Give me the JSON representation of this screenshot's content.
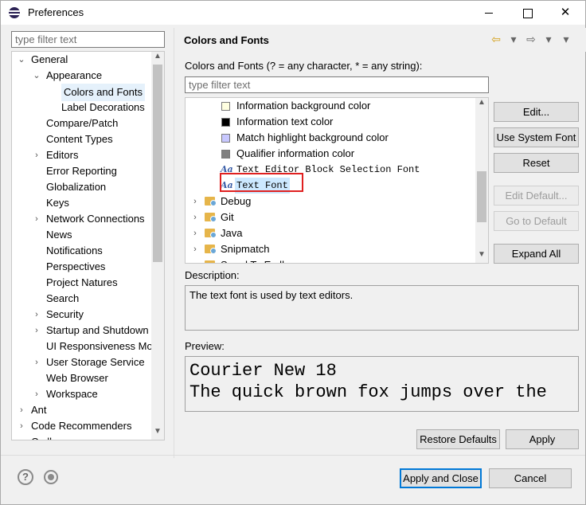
{
  "window": {
    "title": "Preferences",
    "minimize_label": "",
    "close_label": "✕"
  },
  "left": {
    "filter_placeholder": "type filter text",
    "tree": [
      {
        "label": "General",
        "indent": 0,
        "chevron": "⌄"
      },
      {
        "label": "Appearance",
        "indent": 1,
        "chevron": "⌄"
      },
      {
        "label": "Colors and Fonts",
        "indent": 2,
        "chevron": "",
        "selected": true
      },
      {
        "label": "Label Decorations",
        "indent": 2,
        "chevron": ""
      },
      {
        "label": "Compare/Patch",
        "indent": 1,
        "chevron": ""
      },
      {
        "label": "Content Types",
        "indent": 1,
        "chevron": ""
      },
      {
        "label": "Editors",
        "indent": 1,
        "chevron": "›"
      },
      {
        "label": "Error Reporting",
        "indent": 1,
        "chevron": ""
      },
      {
        "label": "Globalization",
        "indent": 1,
        "chevron": ""
      },
      {
        "label": "Keys",
        "indent": 1,
        "chevron": ""
      },
      {
        "label": "Network Connections",
        "indent": 1,
        "chevron": "›"
      },
      {
        "label": "News",
        "indent": 1,
        "chevron": ""
      },
      {
        "label": "Notifications",
        "indent": 1,
        "chevron": ""
      },
      {
        "label": "Perspectives",
        "indent": 1,
        "chevron": ""
      },
      {
        "label": "Project Natures",
        "indent": 1,
        "chevron": ""
      },
      {
        "label": "Search",
        "indent": 1,
        "chevron": ""
      },
      {
        "label": "Security",
        "indent": 1,
        "chevron": "›"
      },
      {
        "label": "Startup and Shutdown",
        "indent": 1,
        "chevron": "›"
      },
      {
        "label": "UI Responsiveness Mo",
        "indent": 1,
        "chevron": ""
      },
      {
        "label": "User Storage Service",
        "indent": 1,
        "chevron": "›"
      },
      {
        "label": "Web Browser",
        "indent": 1,
        "chevron": ""
      },
      {
        "label": "Workspace",
        "indent": 1,
        "chevron": "›"
      },
      {
        "label": "Ant",
        "indent": 0,
        "chevron": "›"
      },
      {
        "label": "Code Recommenders",
        "indent": 0,
        "chevron": "›"
      },
      {
        "label": "C...ll",
        "indent": 0,
        "chevron": ""
      }
    ]
  },
  "page": {
    "title": "Colors and Fonts",
    "nav": {
      "back": "⇦",
      "back_menu": "▾",
      "forward": "⇨",
      "forward_menu": "▾",
      "view_menu": "▾"
    },
    "filter_hint": "Colors and Fonts (? = any character, * = any string):",
    "filter_placeholder": "type filter text",
    "items": [
      {
        "kind": "color",
        "label": "Information background color",
        "color": "#ffffe1"
      },
      {
        "kind": "color",
        "label": "Information text color",
        "color": "#000000"
      },
      {
        "kind": "color",
        "label": "Match highlight background color",
        "color": "#c8c8ff"
      },
      {
        "kind": "color",
        "label": "Qualifier information color",
        "color": "#808080"
      },
      {
        "kind": "font",
        "label": "Text Editor Block Selection Font",
        "icon": "Aa"
      },
      {
        "kind": "font",
        "label": "Text Font",
        "icon": "Aa",
        "selected": true
      },
      {
        "kind": "folder",
        "label": "Debug"
      },
      {
        "kind": "folder",
        "label": "Git"
      },
      {
        "kind": "folder",
        "label": "Java"
      },
      {
        "kind": "folder",
        "label": "Snipmatch"
      },
      {
        "kind": "folder",
        "label": "S...ed T...E...ll"
      }
    ],
    "buttons": {
      "edit": "Edit...",
      "use_system_font": "Use System Font",
      "reset": "Reset",
      "edit_default": "Edit Default...",
      "go_to_default": "Go to Default",
      "expand_all": "Expand All"
    },
    "description_label": "Description:",
    "description_text": "The text font is used by text editors.",
    "preview_label": "Preview:",
    "preview_lines": [
      "Courier New 18",
      "The quick brown fox jumps over the"
    ],
    "restore_defaults": "Restore Defaults",
    "apply": "Apply"
  },
  "footer": {
    "help_glyph": "?",
    "apply_and_close": "Apply and Close",
    "cancel": "Cancel"
  },
  "colors": {
    "accent": "#0078d7",
    "highlight_box": "#e02020",
    "selection": "#cce8ff"
  }
}
